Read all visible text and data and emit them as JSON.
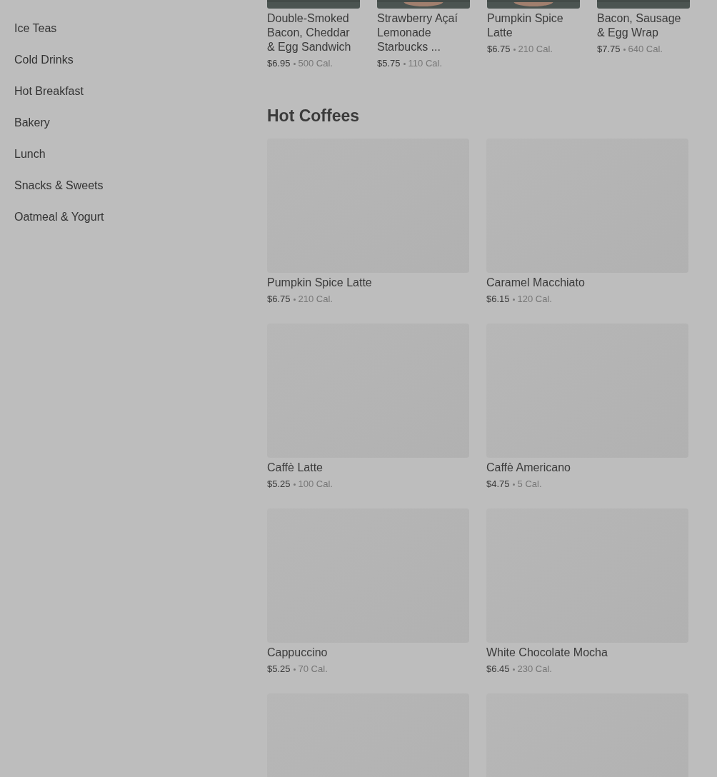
{
  "sidebar": {
    "items": [
      {
        "label": "Ice Teas"
      },
      {
        "label": "Cold Drinks"
      },
      {
        "label": "Hot Breakfast"
      },
      {
        "label": "Bakery"
      },
      {
        "label": "Lunch"
      },
      {
        "label": "Snacks & Sweets"
      },
      {
        "label": "Oatmeal & Yogurt"
      }
    ]
  },
  "featured": [
    {
      "name": "Double-Smoked Bacon, Cheddar & Egg Sandwich",
      "price": "$6.95",
      "calories": "500 Cal."
    },
    {
      "name": "Strawberry Açaí Lemonade Starbucks ...",
      "price": "$5.75",
      "calories": "110 Cal."
    },
    {
      "name": "Pumpkin Spice Latte",
      "price": "$6.75",
      "calories": "210 Cal."
    },
    {
      "name": "Bacon, Sausage & Egg Wrap",
      "price": "$7.75",
      "calories": "640 Cal."
    }
  ],
  "section": {
    "title": "Hot Coffees",
    "items": [
      {
        "kind": "product",
        "name": "Pumpkin Spice Latte",
        "price": "$6.75",
        "calories": "210 Cal."
      },
      {
        "kind": "product",
        "name": "Caramel Macchiato",
        "price": "$6.15",
        "calories": "120 Cal."
      },
      {
        "kind": "product",
        "name": "Caffè Latte",
        "price": "$5.25",
        "calories": "100 Cal."
      },
      {
        "kind": "product",
        "name": "Caffè Americano",
        "price": "$4.75",
        "calories": "5 Cal."
      },
      {
        "kind": "product",
        "name": "Cappuccino",
        "price": "$5.25",
        "calories": "70 Cal."
      },
      {
        "kind": "product",
        "name": "White Chocolate Mocha",
        "price": "$6.45",
        "calories": "230 Cal."
      },
      {
        "kind": "image_only"
      },
      {
        "kind": "image_only"
      }
    ]
  }
}
